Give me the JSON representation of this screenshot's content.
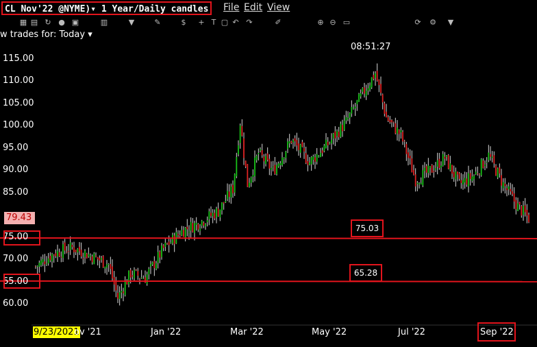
{
  "window": {
    "symbol_label": "CL Nov'22 @NYME)▾ 1 Year/Daily candles",
    "menu": [
      "File",
      "Edit",
      "View"
    ]
  },
  "toolbar": {
    "trades_label": "w trades for:  Today ▾",
    "icons": [
      "grid-icon",
      "table-icon",
      "rotate-icon",
      "circle-icon",
      "camera-icon",
      "chart-icon",
      "dropdown-icon",
      "pen-icon",
      "dollar-icon",
      "crosshair-icon",
      "text-icon",
      "note-icon",
      "undo-icon",
      "redo-icon",
      "draw-icon",
      "magnify-plus-icon",
      "magnify-minus-icon",
      "fit-icon",
      "refresh-icon",
      "settings-icon",
      "dropdown-icon"
    ]
  },
  "clock": "08:51:27",
  "chart_data": {
    "type": "candlestick",
    "title": "CL Nov'22 @NYME) 1 Year/Daily candles",
    "ylim": [
      55,
      119
    ],
    "y_ticks": [
      "115.00",
      "110.00",
      "105.00",
      "100.00",
      "95.00",
      "90.00",
      "85.00",
      "75.00",
      "70.00",
      "65.00",
      "60.00"
    ],
    "x_ticks": [
      "9/23/2021",
      "ov '21",
      "Jan '22",
      "Mar '22",
      "May '22",
      "Jul '22",
      "Sep '22"
    ],
    "current_price": "79.43",
    "horizontal_lines": [
      {
        "value": 75.03,
        "label": "75.03",
        "axis_label": "75.00"
      },
      {
        "value": 65.28,
        "label": "65.28",
        "axis_label": "65.00"
      }
    ],
    "series": [
      {
        "date_index": 0,
        "close": 68.5
      },
      {
        "date_index": 10,
        "close": 71.5
      },
      {
        "date_index": 20,
        "close": 72.8
      },
      {
        "date_index": 30,
        "close": 71.0
      },
      {
        "date_index": 40,
        "close": 69.0
      },
      {
        "date_index": 45,
        "close": 61.5
      },
      {
        "date_index": 52,
        "close": 67.0
      },
      {
        "date_index": 60,
        "close": 66.0
      },
      {
        "date_index": 70,
        "close": 72.5
      },
      {
        "date_index": 80,
        "close": 76.5
      },
      {
        "date_index": 90,
        "close": 78.5
      },
      {
        "date_index": 100,
        "close": 81.0
      },
      {
        "date_index": 108,
        "close": 86.0
      },
      {
        "date_index": 112,
        "close": 101.0
      },
      {
        "date_index": 116,
        "close": 87.0
      },
      {
        "date_index": 122,
        "close": 94.0
      },
      {
        "date_index": 130,
        "close": 90.0
      },
      {
        "date_index": 140,
        "close": 97.0
      },
      {
        "date_index": 150,
        "close": 92.0
      },
      {
        "date_index": 160,
        "close": 96.0
      },
      {
        "date_index": 170,
        "close": 101.0
      },
      {
        "date_index": 180,
        "close": 108.0
      },
      {
        "date_index": 186,
        "close": 112.0
      },
      {
        "date_index": 192,
        "close": 102.0
      },
      {
        "date_index": 200,
        "close": 98.0
      },
      {
        "date_index": 208,
        "close": 88.0
      },
      {
        "date_index": 216,
        "close": 90.0
      },
      {
        "date_index": 224,
        "close": 93.0
      },
      {
        "date_index": 232,
        "close": 87.0
      },
      {
        "date_index": 240,
        "close": 89.0
      },
      {
        "date_index": 248,
        "close": 93.5
      },
      {
        "date_index": 256,
        "close": 87.0
      },
      {
        "date_index": 264,
        "close": 82.0
      },
      {
        "date_index": 270,
        "close": 79.4
      }
    ]
  }
}
